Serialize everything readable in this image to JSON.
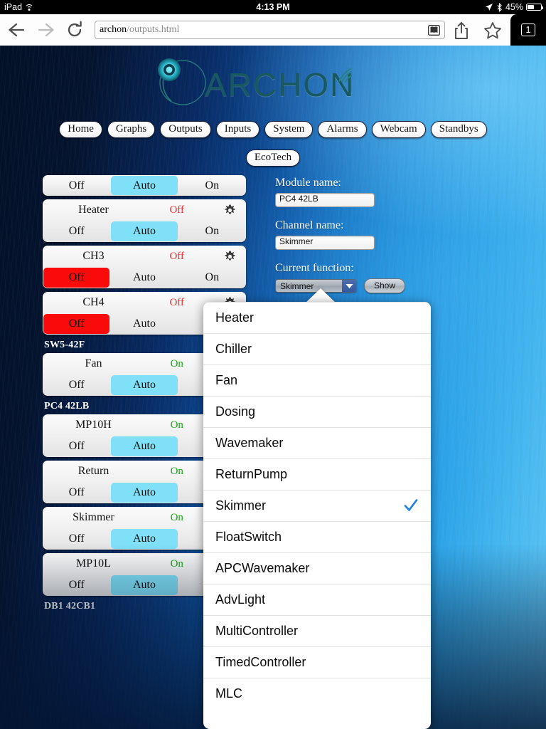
{
  "status_bar": {
    "device": "iPad",
    "wifi_icon": "wifi-icon",
    "time": "4:13 PM",
    "location_icon": "location-arrow-icon",
    "bluetooth_icon": "bluetooth-icon",
    "battery": "45%"
  },
  "browser": {
    "back_icon": "back-arrow-icon",
    "forward_icon": "forward-arrow-icon",
    "reload_icon": "reload-icon",
    "url_bold": "archon",
    "url_dim": "/outputs.html",
    "reader_icon": "reader-view-icon",
    "share_icon": "share-icon",
    "bookmark_icon": "bookmark-star-icon",
    "tab_count": "1"
  },
  "logo": {
    "wordmark": "ARCHON",
    "mark_icon": "archon-circle-icon",
    "signal_icon": "signal-waves-icon",
    "color": "#18585f"
  },
  "nav": {
    "row1": [
      "Home",
      "Graphs",
      "Outputs",
      "Inputs",
      "System",
      "Alarms",
      "Webcam",
      "Standbys"
    ],
    "row2": [
      "EcoTech"
    ]
  },
  "outputs": {
    "groups": [
      {
        "header": null,
        "rows": [
          {
            "partial": true,
            "name": "",
            "state": "",
            "state_kind": "",
            "gear": false,
            "buttons": [
              "Off",
              "Auto",
              "On"
            ],
            "selected": "Auto"
          },
          {
            "partial": false,
            "name": "Heater",
            "state": "Off",
            "state_kind": "off",
            "gear": true,
            "buttons": [
              "Off",
              "Auto",
              "On"
            ],
            "selected": "Auto"
          },
          {
            "partial": false,
            "name": "CH3",
            "state": "Off",
            "state_kind": "off",
            "gear": true,
            "buttons": [
              "Off",
              "Auto",
              "On"
            ],
            "selected": "Off"
          },
          {
            "partial": false,
            "name": "CH4",
            "state": "Off",
            "state_kind": "off",
            "gear": true,
            "buttons": [
              "Off",
              "Auto",
              "On"
            ],
            "selected": "Off"
          }
        ]
      },
      {
        "header": "SW5-42F",
        "rows": [
          {
            "partial": false,
            "name": "Fan",
            "state": "On",
            "state_kind": "on",
            "gear": true,
            "buttons": [
              "Off",
              "Auto",
              "On"
            ],
            "selected": "Auto"
          }
        ]
      },
      {
        "header": "PC4 42LB",
        "rows": [
          {
            "partial": false,
            "name": "MP10H",
            "state": "On",
            "state_kind": "on",
            "gear": true,
            "buttons": [
              "Off",
              "Auto",
              "On"
            ],
            "selected": "Auto"
          },
          {
            "partial": false,
            "name": "Return",
            "state": "On",
            "state_kind": "on",
            "gear": true,
            "buttons": [
              "Off",
              "Auto",
              "On"
            ],
            "selected": "Auto"
          },
          {
            "partial": false,
            "name": "Skimmer",
            "state": "On",
            "state_kind": "on",
            "gear": true,
            "buttons": [
              "Off",
              "Auto",
              "On"
            ],
            "selected": "Auto"
          },
          {
            "partial": false,
            "name": "MP10L",
            "state": "On",
            "state_kind": "on",
            "gear": true,
            "buttons": [
              "Off",
              "Auto",
              "On"
            ],
            "selected": "Auto"
          }
        ]
      },
      {
        "header": "DB1 42CB1",
        "rows": []
      }
    ]
  },
  "form": {
    "module_label": "Module name:",
    "module_value": "PC4 42LB",
    "channel_label": "Channel name:",
    "channel_value": "Skimmer",
    "function_label": "Current function:",
    "function_value": "Skimmer",
    "dropdown_arrow_icon": "chevron-down-icon",
    "show_label": "Show"
  },
  "function_popover": {
    "checked": "Skimmer",
    "check_icon": "checkmark-icon",
    "check_color": "#1a7ee8",
    "items": [
      "Heater",
      "Chiller",
      "Fan",
      "Dosing",
      "Wavemaker",
      "ReturnPump",
      "Skimmer",
      "FloatSwitch",
      "APCWavemaker",
      "AdvLight",
      "MultiController",
      "TimedController",
      "MLC"
    ]
  },
  "colors": {
    "auto_selected": "#7fe0f7",
    "off_selected": "#fb0a0a",
    "state_off": "#ef2b2b",
    "state_on": "#1aa318",
    "page_dark": "#021027",
    "page_light": "#62c6f4"
  }
}
